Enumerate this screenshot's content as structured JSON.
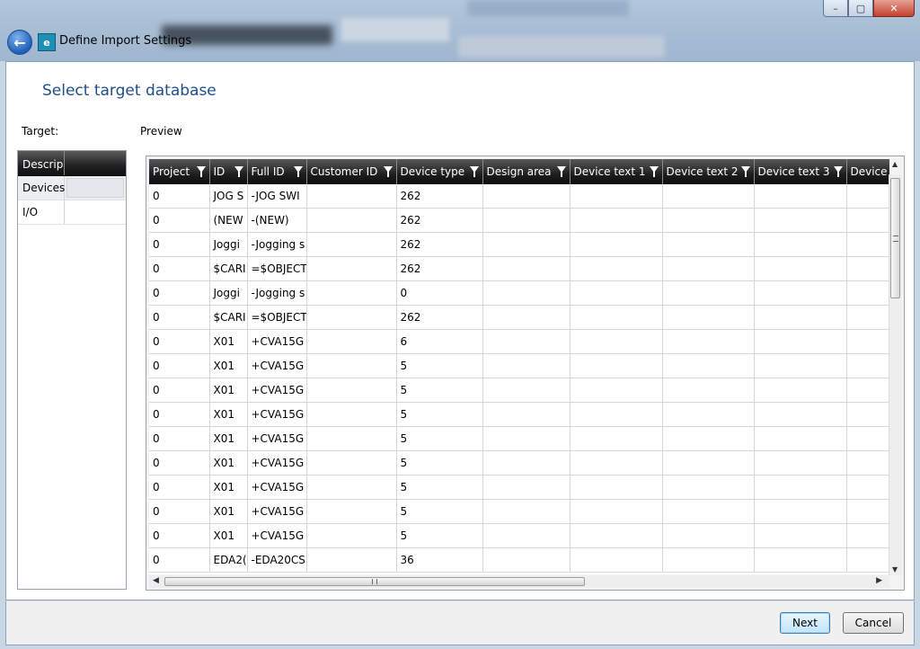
{
  "window": {
    "title": "Define Import Settings",
    "controls": {
      "minimize": "–",
      "maximize": "▢",
      "close": "✕"
    }
  },
  "page": {
    "title": "Select target database",
    "target_label": "Target:",
    "preview_label": "Preview"
  },
  "target": {
    "header": "Descrip",
    "items": [
      {
        "label": "Devices",
        "selected": true
      },
      {
        "label": "I/O",
        "selected": false
      }
    ]
  },
  "grid": {
    "columns": [
      "Project",
      "ID",
      "Full ID",
      "Customer ID",
      "Device type",
      "Design area",
      "Device text 1",
      "Device text 2",
      "Device text 3",
      "Device t"
    ],
    "rows": [
      [
        "0",
        "JOG S",
        "-JOG SWI",
        "",
        "262",
        "",
        "",
        "",
        "",
        ""
      ],
      [
        "0",
        "(NEW",
        "-(NEW)",
        "",
        "262",
        "",
        "",
        "",
        "",
        ""
      ],
      [
        "0",
        "Joggi",
        "-Jogging s",
        "",
        "262",
        "",
        "",
        "",
        "",
        ""
      ],
      [
        "0",
        "$CARI",
        "=$OBJECT",
        "",
        "262",
        "",
        "",
        "",
        "",
        ""
      ],
      [
        "0",
        "Joggi",
        "-Jogging s",
        "",
        "0",
        "",
        "",
        "",
        "",
        ""
      ],
      [
        "0",
        "$CARI",
        "=$OBJECT",
        "",
        "262",
        "",
        "",
        "",
        "",
        ""
      ],
      [
        "0",
        "X01",
        "+CVA15G",
        "",
        "6",
        "",
        "",
        "",
        "",
        ""
      ],
      [
        "0",
        "X01",
        "+CVA15G",
        "",
        "5",
        "",
        "",
        "",
        "",
        ""
      ],
      [
        "0",
        "X01",
        "+CVA15G",
        "",
        "5",
        "",
        "",
        "",
        "",
        ""
      ],
      [
        "0",
        "X01",
        "+CVA15G",
        "",
        "5",
        "",
        "",
        "",
        "",
        ""
      ],
      [
        "0",
        "X01",
        "+CVA15G",
        "",
        "5",
        "",
        "",
        "",
        "",
        ""
      ],
      [
        "0",
        "X01",
        "+CVA15G",
        "",
        "5",
        "",
        "",
        "",
        "",
        ""
      ],
      [
        "0",
        "X01",
        "+CVA15G",
        "",
        "5",
        "",
        "",
        "",
        "",
        ""
      ],
      [
        "0",
        "X01",
        "+CVA15G",
        "",
        "5",
        "",
        "",
        "",
        "",
        ""
      ],
      [
        "0",
        "X01",
        "+CVA15G",
        "",
        "5",
        "",
        "",
        "",
        "",
        ""
      ],
      [
        "0",
        "EDA2(",
        "-EDA20CS",
        "",
        "36",
        "",
        "",
        "",
        "",
        ""
      ]
    ]
  },
  "buttons": {
    "next": "Next",
    "cancel": "Cancel"
  },
  "colors": {
    "accent": "#1e4f8a",
    "header_dark": "#1e1e1e"
  }
}
